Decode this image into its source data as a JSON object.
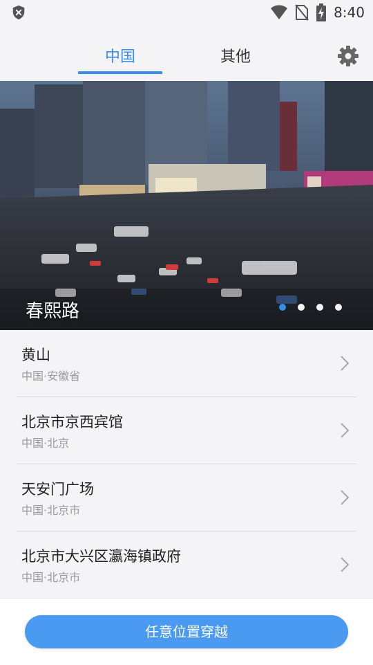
{
  "status_bar": {
    "time": "8:40",
    "icons": [
      "shield-x-icon",
      "wifi-icon",
      "no-sim-icon",
      "battery-charging-icon"
    ]
  },
  "tabs": {
    "items": [
      {
        "label": "中国",
        "selected": true
      },
      {
        "label": "其他",
        "selected": false
      }
    ],
    "settings_icon": "gear-icon"
  },
  "banner": {
    "title": "春熙路",
    "page_count": 4,
    "active_index": 0
  },
  "places": [
    {
      "name": "黄山",
      "region": "中国·安徽省"
    },
    {
      "name": "北京市京西宾馆",
      "region": "中国·北京"
    },
    {
      "name": "天安门广场",
      "region": "中国·北京市"
    },
    {
      "name": "北京市大兴区瀛海镇政府",
      "region": "中国·北京市"
    }
  ],
  "action": {
    "label": "任意位置穿越"
  },
  "colors": {
    "accent": "#3a8ee6",
    "button": "#4a9af2",
    "background": "#f4f4f6"
  }
}
